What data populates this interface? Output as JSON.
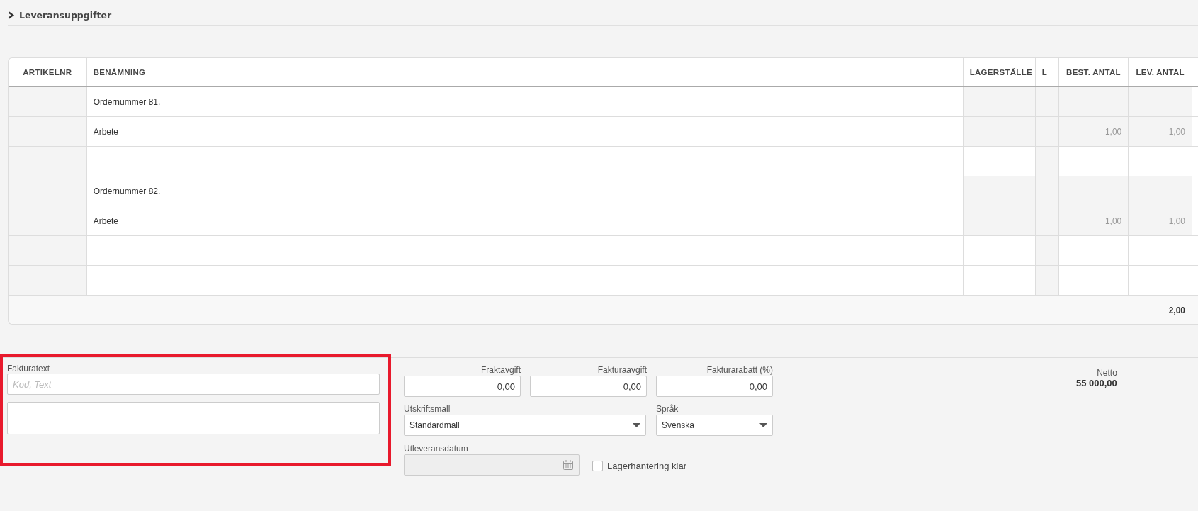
{
  "section": {
    "title": "Leveransuppgifter",
    "expanded": false
  },
  "table": {
    "columns": [
      {
        "label": "ARTIKELNR"
      },
      {
        "label": "BENÄMNING"
      },
      {
        "label": "LAGERSTÄLLE"
      },
      {
        "label": "L"
      },
      {
        "label": "BEST. ANTAL"
      },
      {
        "label": "LEV. ANTAL"
      }
    ],
    "rows": [
      {
        "benamning": "Ordernummer 81."
      },
      {
        "benamning": "Arbete",
        "best_antal": "1,00",
        "lev_antal": "1,00"
      },
      {},
      {
        "benamning": "Ordernummer 82."
      },
      {
        "benamning": "Arbete",
        "best_antal": "1,00",
        "lev_antal": "1,00"
      },
      {},
      {}
    ],
    "footer": {
      "lev_antal_total": "2,00"
    }
  },
  "invoice_text": {
    "label": "Fakturatext",
    "placeholder": "Kod, Text",
    "highlighted": true
  },
  "fees": [
    {
      "label": "Fraktavgift",
      "value": "0,00"
    },
    {
      "label": "Fakturaavgift",
      "value": "0,00"
    },
    {
      "label": "Fakturarabatt (%)",
      "value": "0,00"
    }
  ],
  "print_template": {
    "label": "Utskriftsmall",
    "value": "Standardmall"
  },
  "language": {
    "label": "Språk",
    "value": "Svenska"
  },
  "delivery_date": {
    "label": "Utleveransdatum",
    "disabled": true
  },
  "stock_done": {
    "label": "Lagerhantering klar",
    "checked": false
  },
  "net": {
    "label": "Netto",
    "value": "55 000,00"
  }
}
